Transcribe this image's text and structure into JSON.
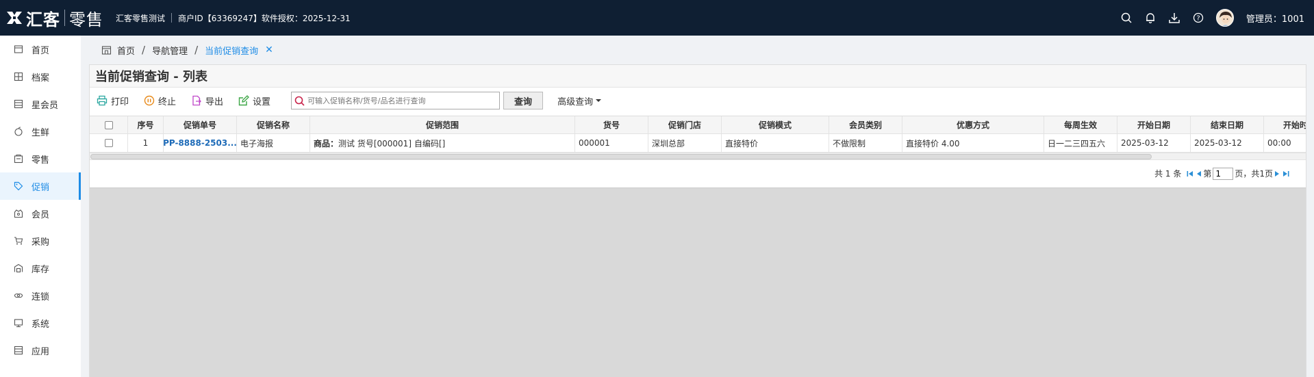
{
  "header": {
    "logo_text1": "汇客",
    "logo_text2": "零售",
    "store_name": "汇客零售测试",
    "merchant_info": "商户ID【63369247】软件授权：2025-12-31",
    "admin_label": "管理员：1001",
    "icons": [
      "search-icon",
      "bell-icon",
      "download-icon",
      "help-icon",
      "avatar"
    ]
  },
  "sidebar": {
    "items": [
      {
        "label": "首页",
        "icon": "home-icon"
      },
      {
        "label": "档案",
        "icon": "archive-icon"
      },
      {
        "label": "星会员",
        "icon": "star-member-icon"
      },
      {
        "label": "生鲜",
        "icon": "fresh-icon"
      },
      {
        "label": "零售",
        "icon": "retail-icon"
      },
      {
        "label": "促销",
        "icon": "tag-icon",
        "active": true
      },
      {
        "label": "会员",
        "icon": "member-icon"
      },
      {
        "label": "采购",
        "icon": "cart-icon"
      },
      {
        "label": "库存",
        "icon": "warehouse-icon"
      },
      {
        "label": "连锁",
        "icon": "chain-icon"
      },
      {
        "label": "系统",
        "icon": "monitor-icon"
      },
      {
        "label": "应用",
        "icon": "app-icon"
      }
    ]
  },
  "breadcrumb": {
    "home": "首页",
    "level2": "导航管理",
    "current": "当前促销查询",
    "close": "✕"
  },
  "panel": {
    "title": "当前促销查询 - 列表"
  },
  "toolbar": {
    "print": "打印",
    "stop": "终止",
    "export": "导出",
    "settings": "设置",
    "search_placeholder": "可输入促销名称/货号/品名进行查询",
    "query": "查询",
    "advanced": "高级查询"
  },
  "table": {
    "columns": [
      "序号",
      "促销单号",
      "促销名称",
      "促销范围",
      "货号",
      "促销门店",
      "促销模式",
      "会员类别",
      "优惠方式",
      "每周生效",
      "开始日期",
      "结束日期",
      "开始时"
    ],
    "rows": [
      {
        "index": "1",
        "order_no": "PP-8888-2503...",
        "name": "电子海报",
        "scope_label": "商品：",
        "scope_value": "测试 货号[000001] 自编码[]",
        "sku": "000001",
        "store": "深圳总部",
        "mode": "直接特价",
        "member_type": "不做限制",
        "discount": "直接特价 4.00",
        "weekly": "日一二三四五六",
        "start_date": "2025-03-12",
        "end_date": "2025-03-12",
        "start_time": "00:00"
      }
    ]
  },
  "pager": {
    "total_text": "共 1 条",
    "page_prefix": "第",
    "page_value": "1",
    "page_suffix": "页，共1页"
  },
  "colors": {
    "topbar": "#0f1f33",
    "accent": "#1e8ce6",
    "link": "#1e6bb8"
  }
}
